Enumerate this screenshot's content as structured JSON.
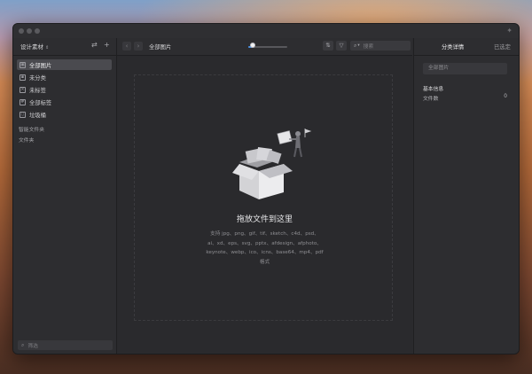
{
  "sidebar": {
    "library_name": "设计素材",
    "items": [
      {
        "label": "全部图片",
        "icon": "images-icon",
        "active": true
      },
      {
        "label": "未分类",
        "icon": "uncategorized-icon",
        "active": false
      },
      {
        "label": "未标签",
        "icon": "untagged-icon",
        "active": false
      },
      {
        "label": "全部标签",
        "icon": "tags-icon",
        "active": false
      },
      {
        "label": "垃圾桶",
        "icon": "trash-icon",
        "active": false
      }
    ],
    "smart_folders_label": "智能文件夹",
    "folders_label": "文件夹",
    "filter_placeholder": "筛选"
  },
  "toolbar": {
    "breadcrumb": "全部图片",
    "zoom_fraction": 0.12,
    "search_placeholder": "搜索"
  },
  "main": {
    "drop_title": "拖放文件到这里",
    "drop_desc_lines": [
      "支持 jpg、png、gif、tif、sketch、c4d、psd、",
      "ai、xd、eps、svg、pptx、afdesign、afphoto、",
      "keynote、webp、ico、icns、base64、mp4、pdf",
      "格式"
    ]
  },
  "right_panel": {
    "tabs": [
      {
        "label": "分类详情",
        "active": true
      },
      {
        "label": "已选定",
        "active": false
      }
    ],
    "name_field": "全部图片",
    "basic_info_label": "基本信息",
    "file_count_label": "文件数",
    "file_count_value": "0"
  },
  "colors": {
    "accent": "#4a90e2",
    "window_bg": "#2b2b2e",
    "active_item_bg": "#4a4a4f"
  }
}
